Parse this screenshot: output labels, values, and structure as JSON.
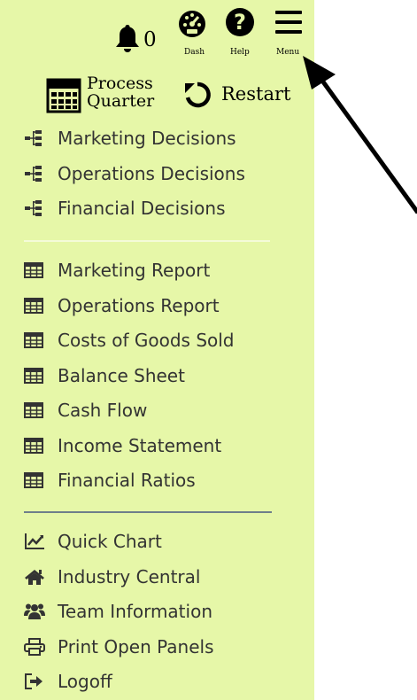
{
  "header": {
    "notification_count": "0",
    "dash_label": "Dash",
    "help_label": "Help",
    "menu_label": "Menu"
  },
  "actions": {
    "process_line1": "Process",
    "process_line2": "Quarter",
    "restart_label": "Restart"
  },
  "decisions": [
    {
      "label": "Marketing Decisions",
      "icon": "sitemap-icon"
    },
    {
      "label": "Operations Decisions",
      "icon": "sitemap-icon"
    },
    {
      "label": "Financial Decisions",
      "icon": "sitemap-icon"
    }
  ],
  "reports": [
    {
      "label": "Marketing Report",
      "icon": "table-icon"
    },
    {
      "label": "Operations Report",
      "icon": "table-icon"
    },
    {
      "label": "Costs of Goods Sold",
      "icon": "table-icon"
    },
    {
      "label": "Balance Sheet",
      "icon": "table-icon"
    },
    {
      "label": "Cash Flow",
      "icon": "table-icon"
    },
    {
      "label": "Income Statement",
      "icon": "table-icon"
    },
    {
      "label": "Financial Ratios",
      "icon": "table-icon"
    }
  ],
  "tools": [
    {
      "label": "Quick Chart",
      "icon": "line-chart-icon"
    },
    {
      "label": "Industry Central",
      "icon": "home-icon"
    },
    {
      "label": "Team Information",
      "icon": "team-icon"
    },
    {
      "label": "Print Open Panels",
      "icon": "print-icon"
    },
    {
      "label": "Logoff",
      "icon": "logoff-icon"
    }
  ]
}
